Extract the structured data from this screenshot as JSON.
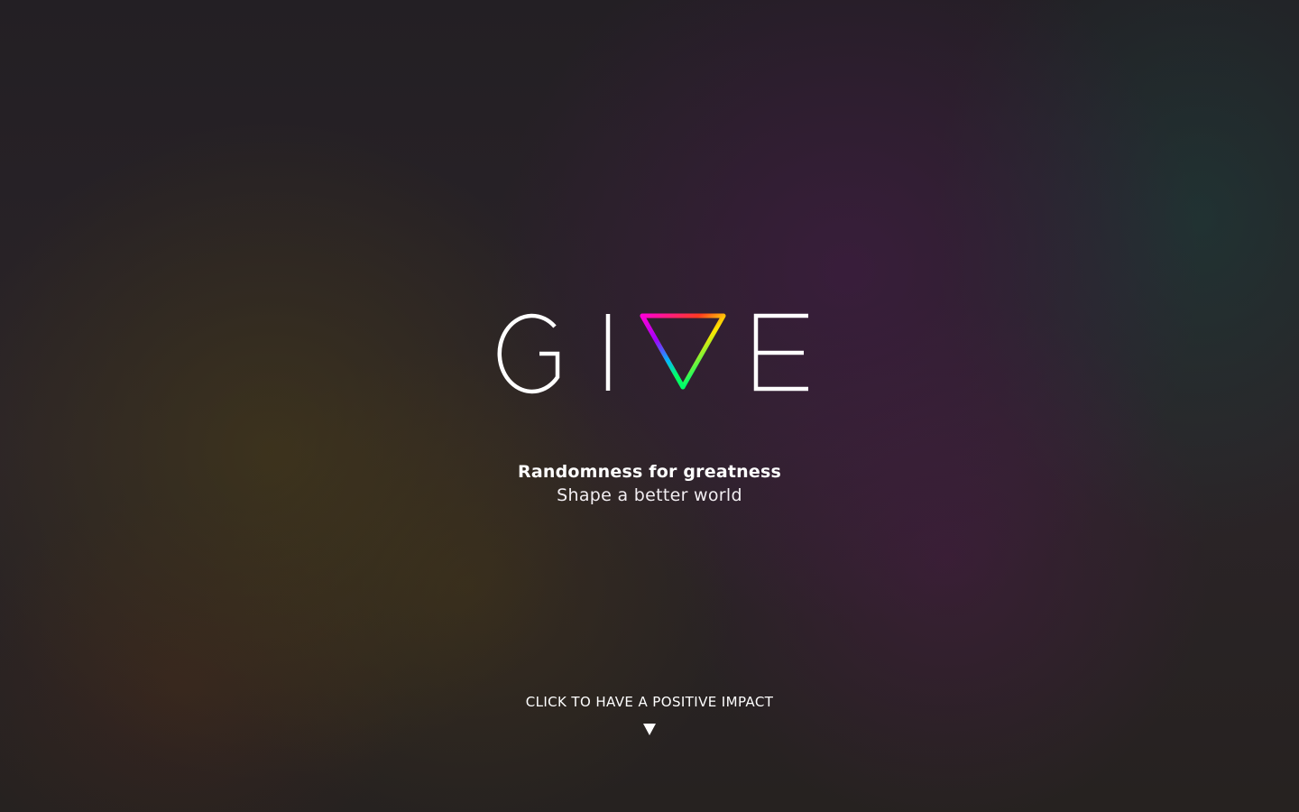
{
  "logo": {
    "text": "GIVE",
    "icon": "rainbow-triangle-icon"
  },
  "tagline": {
    "main": "Randomness for greatness",
    "sub": "Shape a better world"
  },
  "cta": {
    "label": "CLICK TO HAVE A POSITIVE IMPACT",
    "icon": "down-triangle-icon"
  },
  "colors": {
    "text": "#ffffff",
    "rainbow": [
      "#ff00c8",
      "#ff2a2a",
      "#ffdd00",
      "#00ff66",
      "#00b7ff",
      "#b000ff"
    ]
  }
}
